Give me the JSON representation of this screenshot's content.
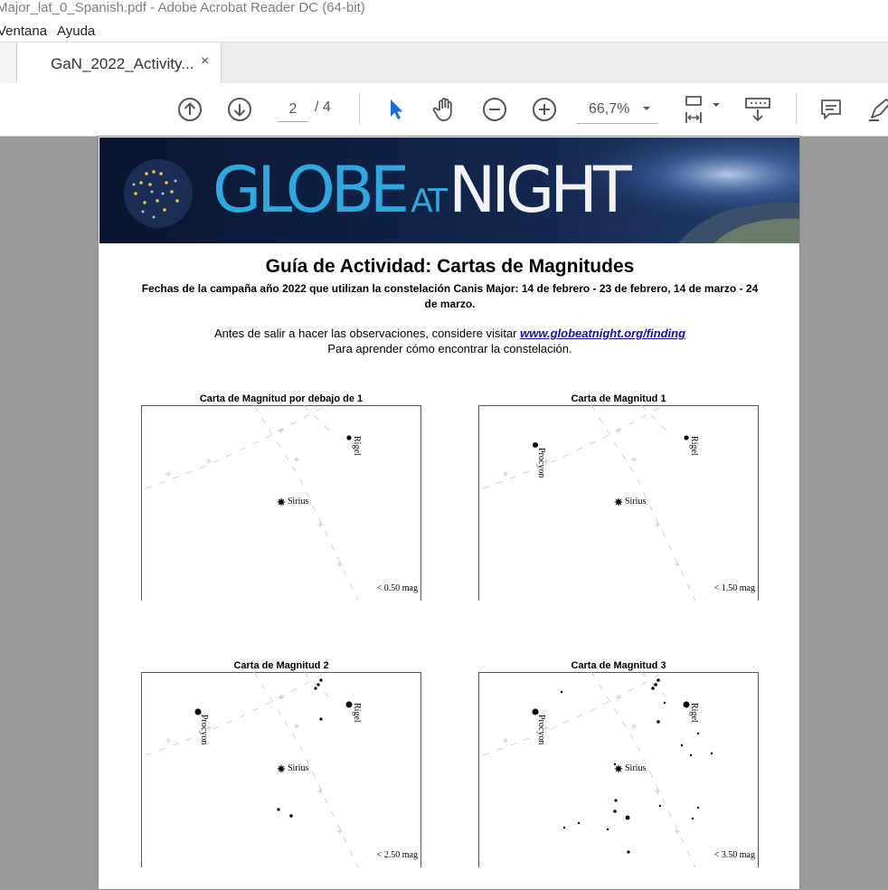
{
  "window": {
    "title": "Major_lat_0_Spanish.pdf - Adobe Acrobat Reader DC (64-bit)"
  },
  "menu": {
    "items": [
      "Ventana",
      "Ayuda"
    ]
  },
  "tab": {
    "label": "GaN_2022_Activity...",
    "close": "×"
  },
  "toolbar": {
    "current_page": "2",
    "total_pages": "/ 4",
    "zoom": "66,7%",
    "icons": [
      "arrow-up-icon",
      "arrow-down-icon",
      "pointer-icon",
      "hand-icon",
      "zoom-out-icon",
      "zoom-in-icon",
      "fit-page-icon",
      "scroll-mode-icon",
      "comment-icon",
      "highlight-icon"
    ]
  },
  "document": {
    "banner": {
      "word1": "GLOBE",
      "word2": "AT",
      "word3": "NIGHT"
    },
    "title": "Guía de Actividad: Cartas de Magnitudes",
    "subtitle": "Fechas de la campaña año 2022 que utilizan la constelación Canis Major: 14 de febrero - 23 de febrero, 14 de marzo - 24 de marzo.",
    "p1_before": "Antes de salir a hacer las observaciones, considere visitar ",
    "p1_link": "www.globeatnight.org/finding",
    "p2": "Para aprender cómo encontrar la constelación."
  },
  "charts": [
    {
      "title": "Carta de Magnitud por debajo de  1",
      "mag_label": "< 0.50 mag",
      "stars": [
        {
          "name": "Rigel",
          "size": 2.6
        },
        {
          "name": "Sirius",
          "size": 5
        }
      ]
    },
    {
      "title": "Carta de Magnitud 1",
      "mag_label": "< 1.50 mag",
      "stars": [
        {
          "name": "Rigel",
          "size": 2.6
        },
        {
          "name": "Procyon",
          "size": 3
        },
        {
          "name": "Sirius",
          "size": 5
        }
      ]
    },
    {
      "title": "Carta de Magnitud 2",
      "mag_label": "< 2.50 mag",
      "stars": [
        {
          "name": "Rigel",
          "size": 3.5
        },
        {
          "name": "Procyon",
          "size": 3.5
        },
        {
          "name": "Sirius",
          "size": 5
        }
      ]
    },
    {
      "title": "Carta de Magnitud 3",
      "mag_label": "< 3.50 mag",
      "stars": [
        {
          "name": "Rigel",
          "size": 3.5
        },
        {
          "name": "Procyon",
          "size": 3.5
        },
        {
          "name": "Sirius",
          "size": 5
        }
      ]
    }
  ]
}
